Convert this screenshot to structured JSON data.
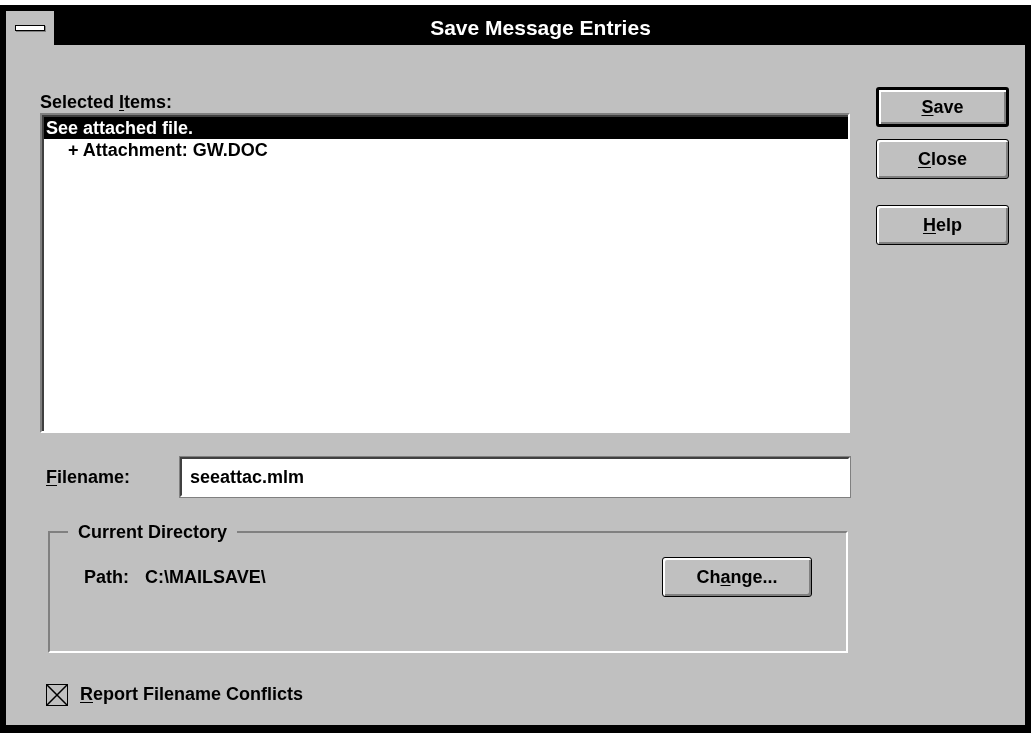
{
  "window": {
    "title": "Save Message Entries"
  },
  "selected_items": {
    "label": [
      {
        "text": "Selected ",
        "underlined": false
      },
      {
        "text": "I",
        "underlined": true
      },
      {
        "text": "tems:",
        "underlined": false
      }
    ],
    "items": [
      {
        "label": "See attached file.",
        "selected": true,
        "children": [
          {
            "label": "+ Attachment: GW.DOC",
            "selected": false
          }
        ]
      }
    ]
  },
  "filename": {
    "label": [
      {
        "text": "F",
        "underlined": true
      },
      {
        "text": "ilename:",
        "underlined": false
      }
    ],
    "value": "seeattac.mlm"
  },
  "current_directory": {
    "title": "Current Directory",
    "path_label": "Path:",
    "path": "C:\\MAILSAVE\\",
    "button": {
      "label": [
        {
          "text": "Ch",
          "underlined": false
        },
        {
          "text": "a",
          "underlined": true
        },
        {
          "text": "nge...",
          "underlined": false
        }
      ],
      "default": false
    }
  },
  "report_conflicts": {
    "label": [
      {
        "text": "R",
        "underlined": true
      },
      {
        "text": "eport Filename Conflicts",
        "underlined": false
      }
    ],
    "checked": true
  },
  "buttons": [
    {
      "label": [
        {
          "text": "S",
          "underlined": true
        },
        {
          "text": "ave",
          "underlined": false
        }
      ],
      "default": true
    },
    {
      "label": [
        {
          "text": "C",
          "underlined": true
        },
        {
          "text": "lose",
          "underlined": false
        }
      ],
      "default": false
    },
    {
      "label": [
        {
          "text": "H",
          "underlined": true
        },
        {
          "text": "elp",
          "underlined": false
        }
      ],
      "default": false
    }
  ]
}
